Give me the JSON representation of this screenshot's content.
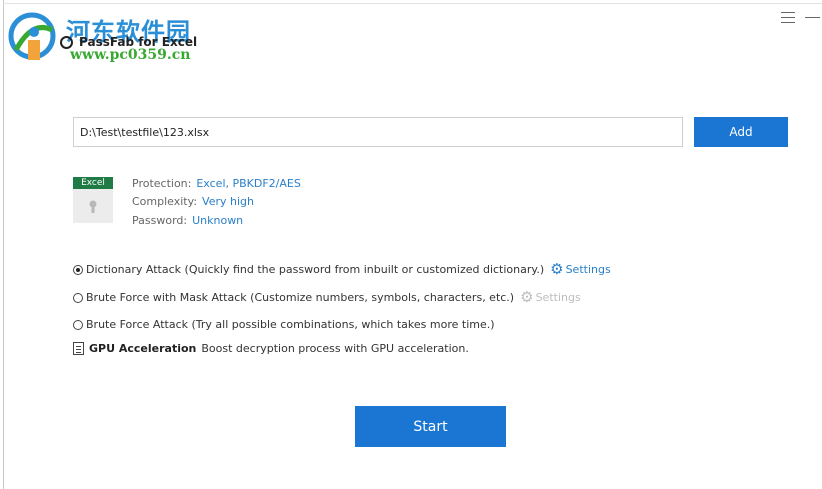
{
  "watermark": {
    "site_name": "河东软件园",
    "url": "www.pc0359.cn"
  },
  "app": {
    "title": "PassFab for Excel"
  },
  "window_controls": {
    "menu_icon": "hamburger-icon",
    "minimize_icon": "minimize-icon"
  },
  "file": {
    "path": "D:\\Test\\testfile\\123.xlsx",
    "add_label": "Add",
    "badge": "Excel",
    "protection_label": "Protection:",
    "protection_value": "Excel, PBKDF2/AES",
    "complexity_label": "Complexity:",
    "complexity_value": "Very high",
    "password_label": "Password:",
    "password_value": "Unknown"
  },
  "attack_options": [
    {
      "label": "Dictionary Attack (Quickly find the password from inbuilt or customized dictionary.)",
      "selected": true,
      "settings_label": "Settings",
      "settings_enabled": true
    },
    {
      "label": "Brute Force with Mask Attack (Customize numbers, symbols, characters, etc.)",
      "selected": false,
      "settings_label": "Settings",
      "settings_enabled": false
    },
    {
      "label": "Brute Force Attack (Try all possible combinations, which takes more time.)",
      "selected": false
    }
  ],
  "gpu": {
    "title": "GPU Acceleration",
    "description": "Boost decryption process with GPU acceleration."
  },
  "start_label": "Start",
  "colors": {
    "accent": "#1a76d2",
    "link": "#2a7fc9",
    "excel_badge": "#1f7a45",
    "watermark_blue": "#2a8fd6",
    "watermark_green": "#39a833"
  }
}
